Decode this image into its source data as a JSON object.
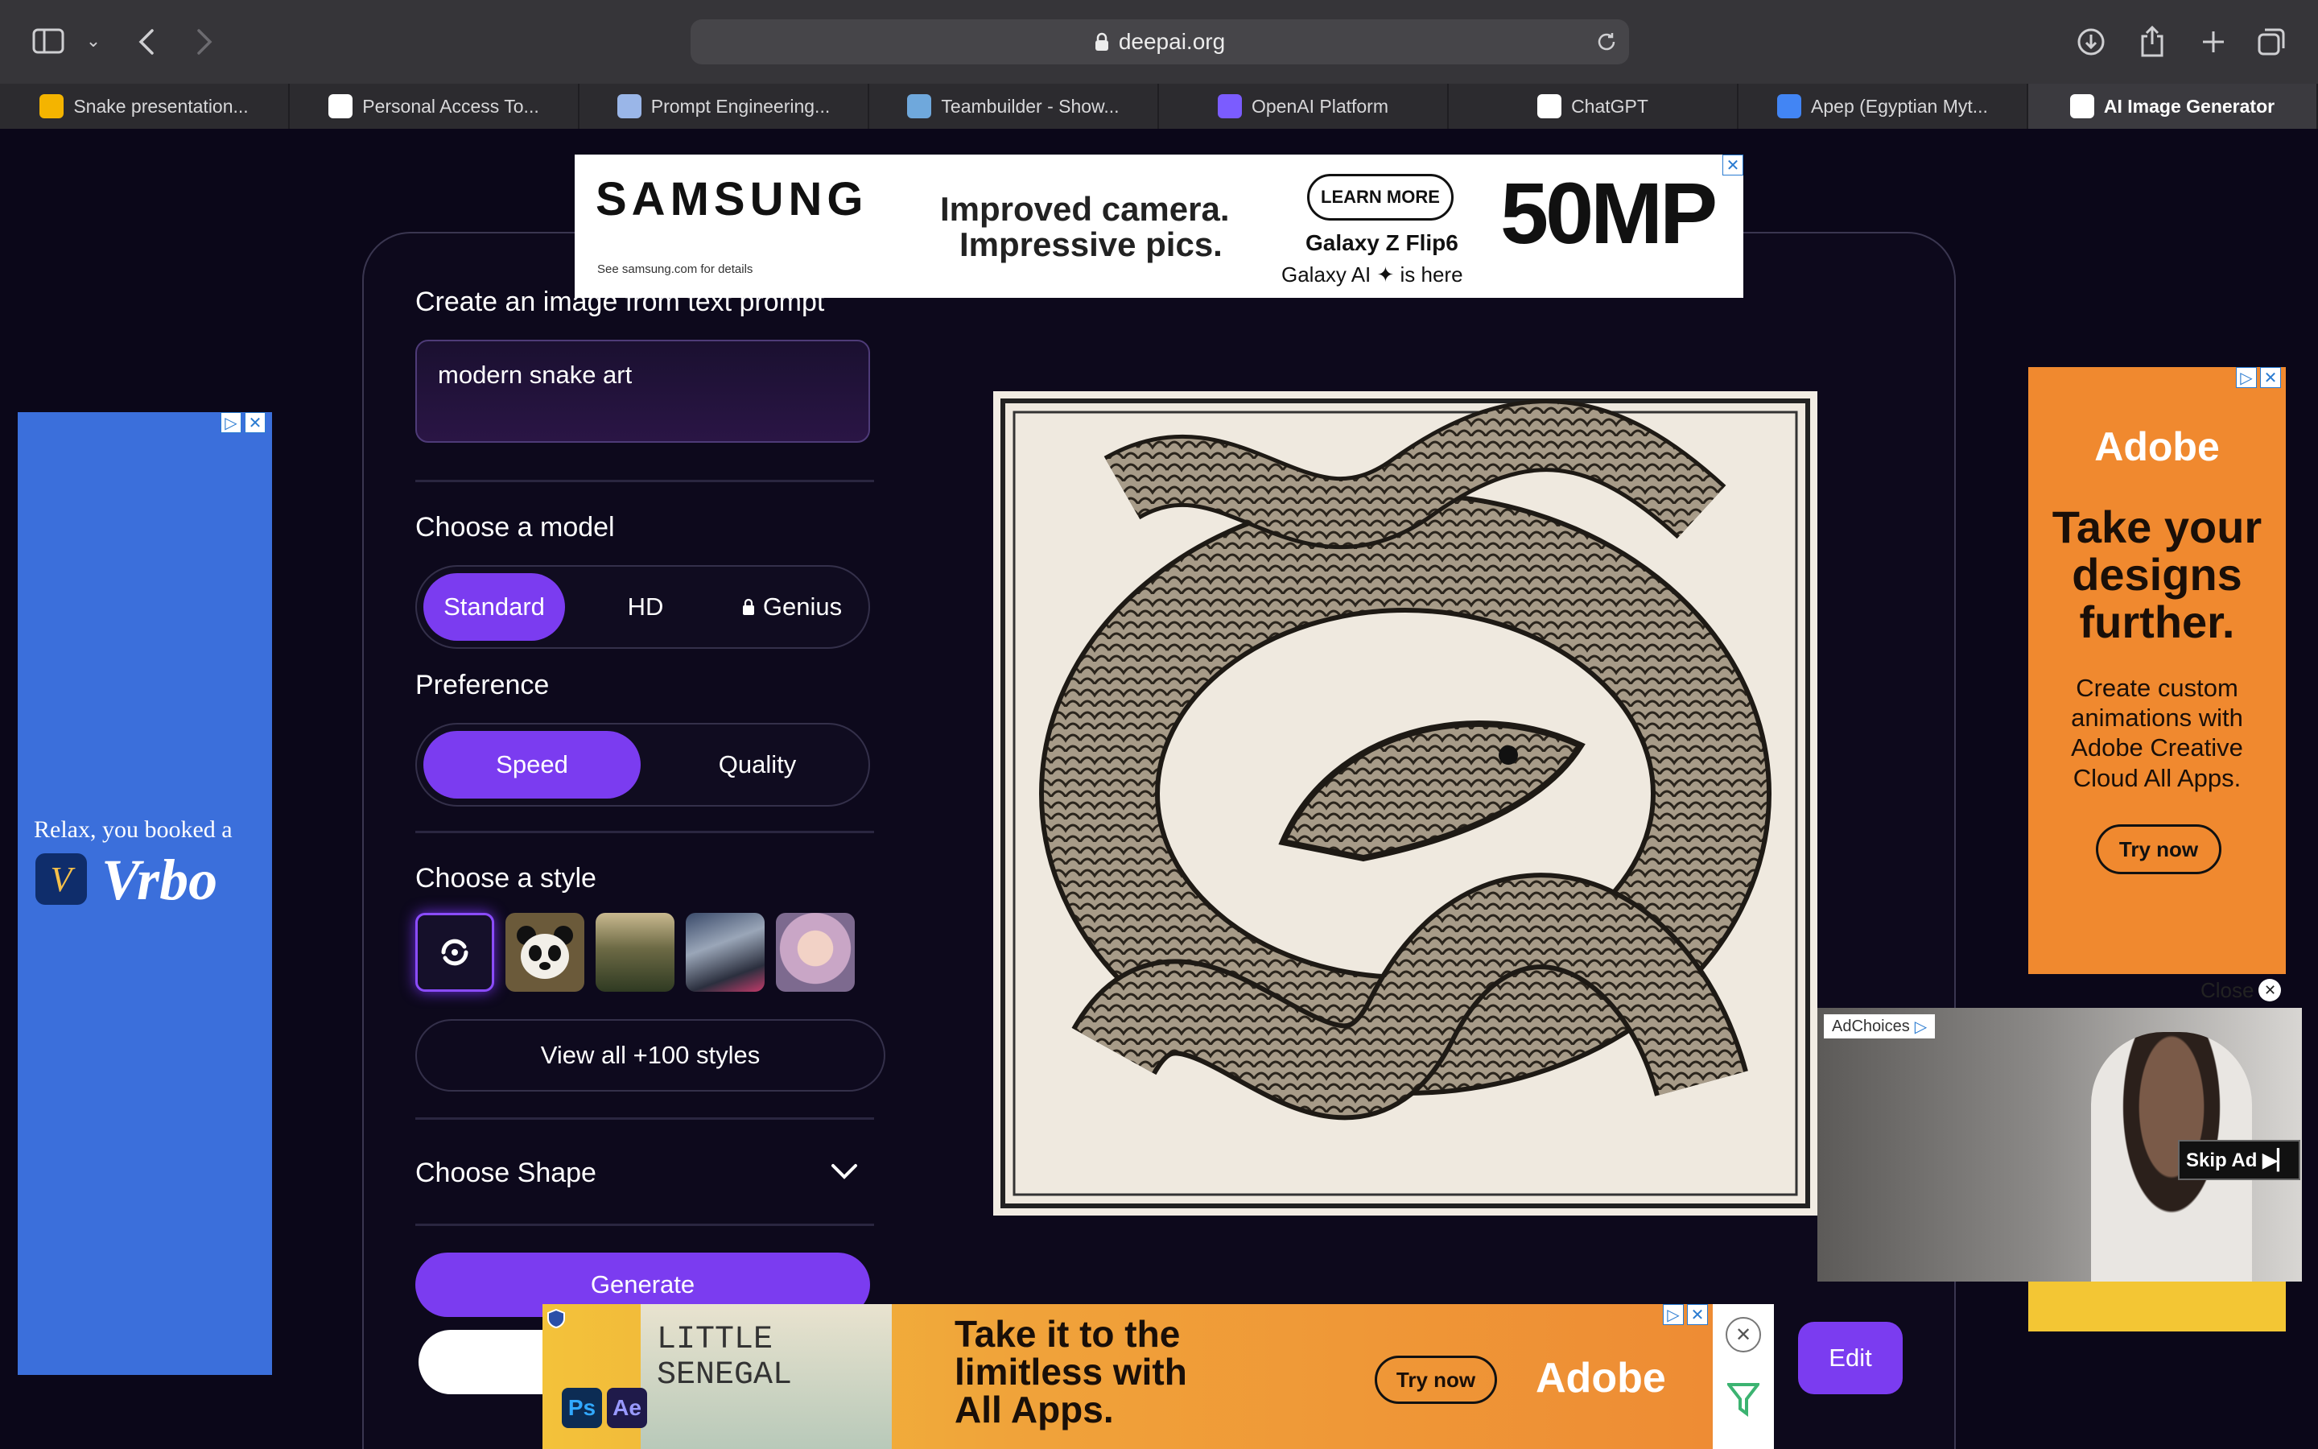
{
  "browser": {
    "url": "deepai.org",
    "tabs": [
      {
        "label": "Snake presentation...",
        "icon": "slides-icon",
        "color": "#f4b400"
      },
      {
        "label": "Personal Access To...",
        "icon": "github-icon",
        "color": "#ffffff"
      },
      {
        "label": "Prompt Engineering...",
        "icon": "doc-icon",
        "color": "#9ab6e8"
      },
      {
        "label": "Teambuilder - Show...",
        "icon": "teambuilder-icon",
        "color": "#6fa8dc"
      },
      {
        "label": "OpenAI Platform",
        "icon": "openai-icon",
        "color": "#7b5cff"
      },
      {
        "label": "ChatGPT",
        "icon": "chatgpt-icon",
        "color": "#ffffff"
      },
      {
        "label": "Apep (Egyptian Myt...",
        "icon": "google-icon",
        "color": "#4285f4"
      },
      {
        "label": "AI Image Generator",
        "icon": "deepai-icon",
        "color": "#ffffff"
      }
    ]
  },
  "generator": {
    "heading": "Create an image from text prompt",
    "prompt_value": "modern snake art",
    "model_title": "Choose a model",
    "models": [
      "Standard",
      "HD",
      "Genius"
    ],
    "selected_model": "Standard",
    "preference_title": "Preference",
    "preferences": [
      "Speed",
      "Quality"
    ],
    "selected_preference": "Speed",
    "style_title": "Choose a style",
    "view_styles_label": "View all +100 styles",
    "shape_title": "Choose Shape",
    "generate_label": "Generate",
    "edit_label": "Edit",
    "accent": "#7b3cf0"
  },
  "ads": {
    "top": {
      "brand": "SAMSUNG",
      "headline_1": "Improved camera.",
      "headline_2": "Impressive pics.",
      "cta": "LEARN MORE",
      "product": "Galaxy Z Flip6",
      "tagline": "Galaxy AI ✦ is here",
      "mp": "50MP",
      "fineprint": "See samsung.com for details"
    },
    "left": {
      "text": "Relax, you booked a",
      "brand": "Vrbo",
      "bg": "#3b6fdb"
    },
    "right": {
      "brand": "Adobe",
      "headline": "Take your designs further.",
      "body": "Create custom animations with Adobe Creative Cloud All Apps.",
      "cta": "Try now",
      "bg": "#f0892f"
    },
    "video": {
      "adchoices": "AdChoices",
      "skip": "Skip Ad ▶▏",
      "close": "Close"
    },
    "bottom": {
      "art_text_1": "LITTLE",
      "art_text_2": "SENEGAL",
      "headline": "Take it to the limitless with All Apps.",
      "cta": "Try now",
      "brand": "Adobe",
      "app_1": "Ps",
      "app_2": "Ae"
    }
  }
}
